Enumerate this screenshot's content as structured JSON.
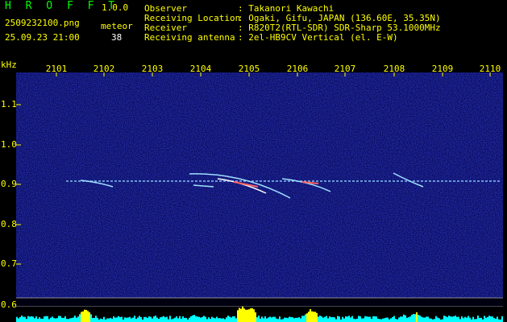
{
  "app": {
    "name": "H R O F F T",
    "version": "1.0.0"
  },
  "file": {
    "name": "2509232100.png",
    "datetime": "25.09.23 21:00"
  },
  "meteor": {
    "label": "meteor",
    "count": "38"
  },
  "info": [
    {
      "key": "Observer",
      "value": ": Takanori Kawachi"
    },
    {
      "key": "Receiving Location",
      "value": ": Ogaki, Gifu, JAPAN (136.60E, 35.35N)"
    },
    {
      "key": "Receiver",
      "value": ": R820T2(RTL-SDR) SDR-Sharp 53.1000MHz"
    },
    {
      "key": "Receiving antenna",
      "value": ": 2el-HB9CV Vertical (el. E-W)"
    }
  ],
  "axis": {
    "unit": "kHz",
    "x_ticks": [
      "2101",
      "2102",
      "2103",
      "2104",
      "2105",
      "2106",
      "2107",
      "2108",
      "2109",
      "2110"
    ],
    "y_ticks": [
      "1.1",
      "1.0",
      "0.9",
      "0.8",
      "0.7",
      "0.6"
    ]
  },
  "colors": {
    "background": "#000000",
    "spectrum": "#0a0a5a",
    "text_yellow": "#ffff00",
    "text_green": "#00ff00",
    "echo": "#a0e0ff",
    "histogram": "#00ffff",
    "histogram_peak": "#ffff00"
  }
}
